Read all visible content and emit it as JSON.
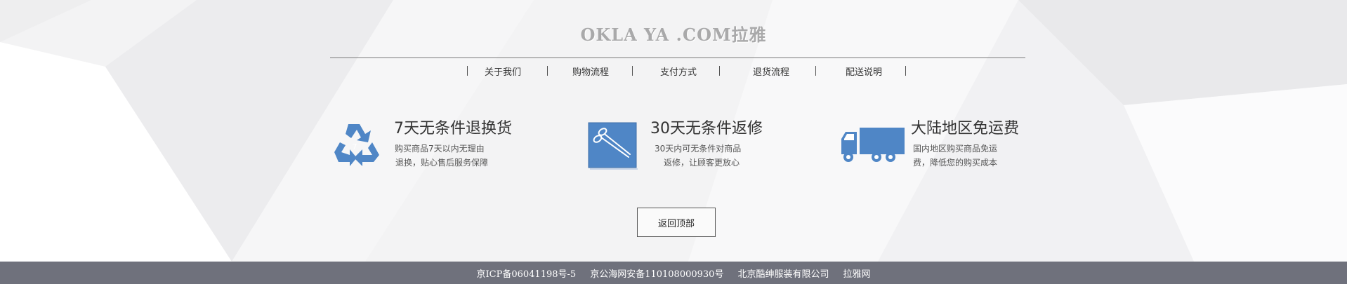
{
  "brand": {
    "text": "OKLA YA .COM拉雅"
  },
  "nav": {
    "items": [
      {
        "label": "关于我们"
      },
      {
        "label": "购物流程"
      },
      {
        "label": "支付方式"
      },
      {
        "label": "退货流程"
      },
      {
        "label": "配送说明"
      }
    ]
  },
  "features": [
    {
      "icon": "recycle-icon",
      "title": "7天无条件退换货",
      "desc_line1": "购买商品7天以内无理由",
      "desc_line2": "退换，贴心售后服务保障"
    },
    {
      "icon": "scissors-icon",
      "title": "30天无条件返修",
      "desc_line1": "30天内可无条件对商品",
      "desc_line2": "返修，让顾客更放心"
    },
    {
      "icon": "truck-icon",
      "title": "大陆地区免运费",
      "desc_line1": "国内地区购买商品免运",
      "desc_line2": "费，降低您的购买成本"
    }
  ],
  "back_to_top": {
    "label": "返回顶部"
  },
  "footer": {
    "icp": "京ICP备06041198号-5",
    "police": "京公海网安备110108000930号",
    "company": "北京酷绅服装有限公司",
    "site": "拉雅网"
  },
  "colors": {
    "icon_blue": "#4f86c6",
    "footer_bg": "#6f717c",
    "background": "#f3f3f4"
  }
}
